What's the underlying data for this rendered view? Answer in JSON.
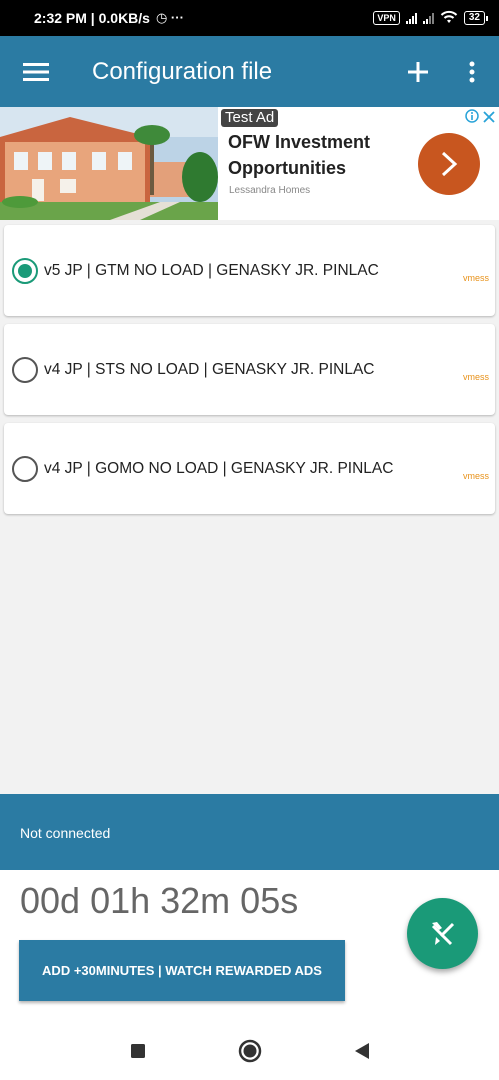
{
  "status_bar": {
    "time_and_speed": "2:32 PM | 0.0KB/s",
    "extra": "◷ ···",
    "vpn": "VPN",
    "battery": "32"
  },
  "app_bar": {
    "title": "Configuration file",
    "menu_icon": "hamburger-menu-icon",
    "add_icon": "plus-icon",
    "overflow_icon": "more-vertical-icon"
  },
  "ad": {
    "label": "Test Ad",
    "title": "OFW Investment Opportunities",
    "advertiser": "Lessandra Homes",
    "cta_icon": "chevron-right-icon"
  },
  "configs": [
    {
      "name": "v5 JP | GTM NO LOAD | GENASKY JR. PINLAC",
      "type": "vmess",
      "selected": true
    },
    {
      "name": "v4 JP | STS NO LOAD | GENASKY JR. PINLAC",
      "type": "vmess",
      "selected": false
    },
    {
      "name": "v4 JP | GOMO NO LOAD | GENASKY JR. PINLAC",
      "type": "vmess",
      "selected": false
    }
  ],
  "connection": {
    "status": "Not connected",
    "timer": "00d 01h 32m 05s",
    "reward_button": "ADD +30MINUTES | WATCH REWARDED ADS",
    "fab_icon": "airplane-off-icon"
  },
  "colors": {
    "primary": "#2b7ba3",
    "accent": "#1a9a78",
    "ad_cta": "#c8561f",
    "type_label": "#e8921a"
  }
}
